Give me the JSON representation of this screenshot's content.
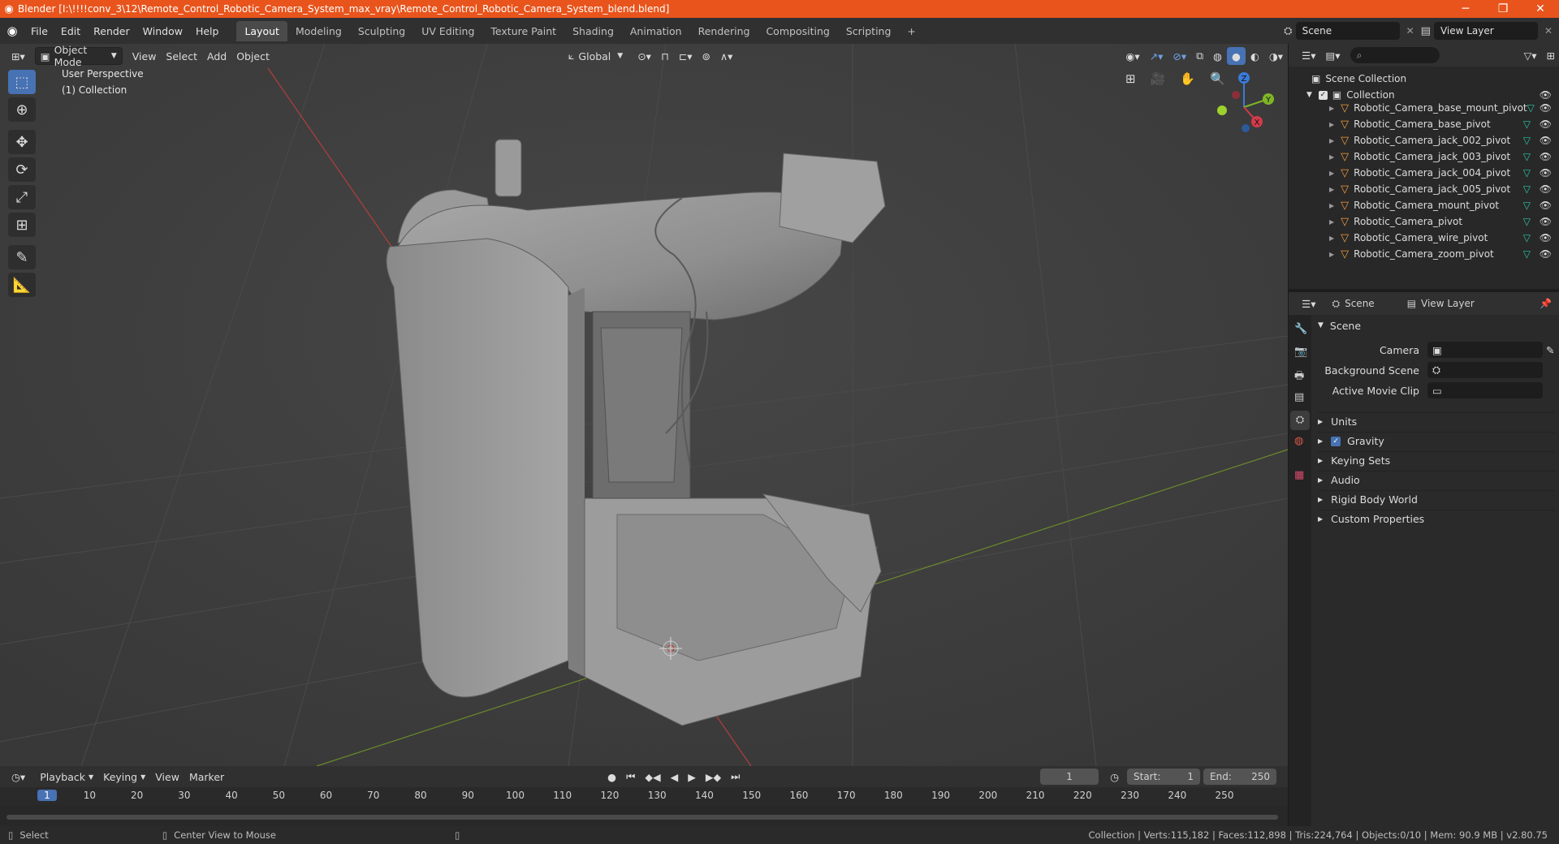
{
  "window": {
    "title": "Blender [I:\\!!!!conv_3\\12\\Remote_Control_Robotic_Camera_System_max_vray\\Remote_Control_Robotic_Camera_System_blend.blend]",
    "minimize": "─",
    "maximize": "❐",
    "close": "✕"
  },
  "menu": [
    "File",
    "Edit",
    "Render",
    "Window",
    "Help"
  ],
  "workspaces": [
    "Layout",
    "Modeling",
    "Sculpting",
    "UV Editing",
    "Texture Paint",
    "Shading",
    "Animation",
    "Rendering",
    "Compositing",
    "Scripting"
  ],
  "workspace_active": "Layout",
  "add_workspace": "+",
  "scene_field": "Scene",
  "viewlayer_field": "View Layer",
  "viewport": {
    "mode": "Object Mode",
    "menus": [
      "View",
      "Select",
      "Add",
      "Object"
    ],
    "orientation": "Global",
    "overlay_text_1": "User Perspective",
    "overlay_text_2": "(1) Collection",
    "gizmo": {
      "z": "Z",
      "y": "Y",
      "x": "X"
    }
  },
  "outliner": {
    "root": "Scene Collection",
    "collection": "Collection",
    "items": [
      "Robotic_Camera_base_mount_pivot",
      "Robotic_Camera_base_pivot",
      "Robotic_Camera_jack_002_pivot",
      "Robotic_Camera_jack_003_pivot",
      "Robotic_Camera_jack_004_pivot",
      "Robotic_Camera_jack_005_pivot",
      "Robotic_Camera_mount_pivot",
      "Robotic_Camera_pivot",
      "Robotic_Camera_wire_pivot",
      "Robotic_Camera_zoom_pivot"
    ]
  },
  "properties": {
    "breadcrumb_scene": "Scene",
    "breadcrumb_viewlayer": "View Layer",
    "section": "Scene",
    "camera_label": "Camera",
    "background_scene_label": "Background Scene",
    "active_movie_clip_label": "Active Movie Clip",
    "panels": [
      "Units",
      "Gravity",
      "Keying Sets",
      "Audio",
      "Rigid Body World",
      "Custom Properties"
    ]
  },
  "timeline": {
    "menus": [
      "Playback",
      "Keying",
      "View",
      "Marker"
    ],
    "current_frame": "1",
    "start_label": "Start:",
    "start": "1",
    "end_label": "End:",
    "end": "250",
    "ruler": [
      "1",
      "10",
      "20",
      "30",
      "40",
      "50",
      "60",
      "70",
      "80",
      "90",
      "100",
      "110",
      "120",
      "130",
      "140",
      "150",
      "160",
      "170",
      "180",
      "190",
      "200",
      "210",
      "220",
      "230",
      "240",
      "250"
    ]
  },
  "status": {
    "select": "Select",
    "center_view": "Center View to Mouse",
    "stats": "Collection | Verts:115,182 | Faces:112,898 | Tris:224,764 | Objects:0/10 | Mem: 90.9 MB | v2.80.75"
  },
  "colors": {
    "titlebar": "#e8541c",
    "accent": "#4772b3",
    "vertex_icon": "#29c4a9",
    "object_icon": "#f29b3a"
  }
}
